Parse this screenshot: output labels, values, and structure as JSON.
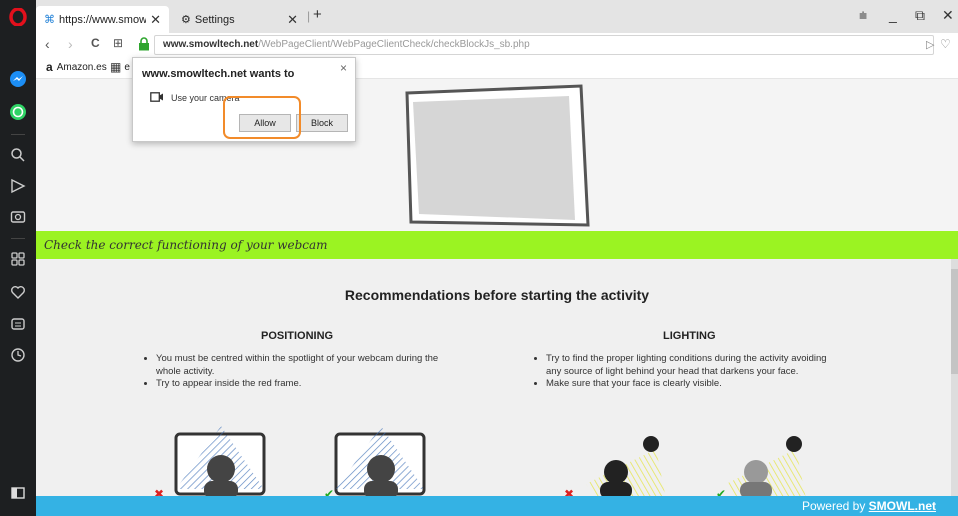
{
  "tabs": [
    {
      "label": "https://www.smowltech.ne",
      "close": "✕"
    },
    {
      "label": "Settings",
      "close": "✕"
    }
  ],
  "new_tab": "+",
  "window_controls": {
    "menu": "⩧",
    "minimize": "_",
    "restore": "⧉",
    "close": "✕"
  },
  "address": {
    "domain": "www.smowltech.net",
    "path": "/WebPageClient/WebPageClientCheck/checkBlockJs_sb.php"
  },
  "nav": {
    "back": "‹",
    "forward": "›",
    "reload": "C",
    "speed_dial": "⊞"
  },
  "bookmarks": [
    {
      "icon": "a",
      "label": "Amazon.es"
    },
    {
      "icon": "▦",
      "label": "e"
    }
  ],
  "popup": {
    "title": "www.smowltech.net wants to",
    "close": "×",
    "permission": "Use your camera",
    "allow": "Allow",
    "block": "Block"
  },
  "green_bar_text": "Check the correct functioning of your webcam",
  "recommendations_title": "Recommendations before starting the activity",
  "positioning": {
    "title": "POSITIONING",
    "bullets": [
      "You must be centred within the spotlight of your webcam during the whole activity.",
      "Try to appear inside the red frame."
    ]
  },
  "lighting": {
    "title": "LIGHTING",
    "bullets": [
      "Try to find the proper lighting conditions during the activity avoiding any source of light behind your head that darkens your face.",
      "Make sure that your face is clearly visible."
    ]
  },
  "footer": {
    "prefix": "Powered by ",
    "brand": "SMOWL",
    "suffix": ".net"
  },
  "colors": {
    "accent_green": "#9bf322",
    "footer_blue": "#34b2e4",
    "highlight_orange": "#f28b2a",
    "opera_red": "#e3101c"
  }
}
